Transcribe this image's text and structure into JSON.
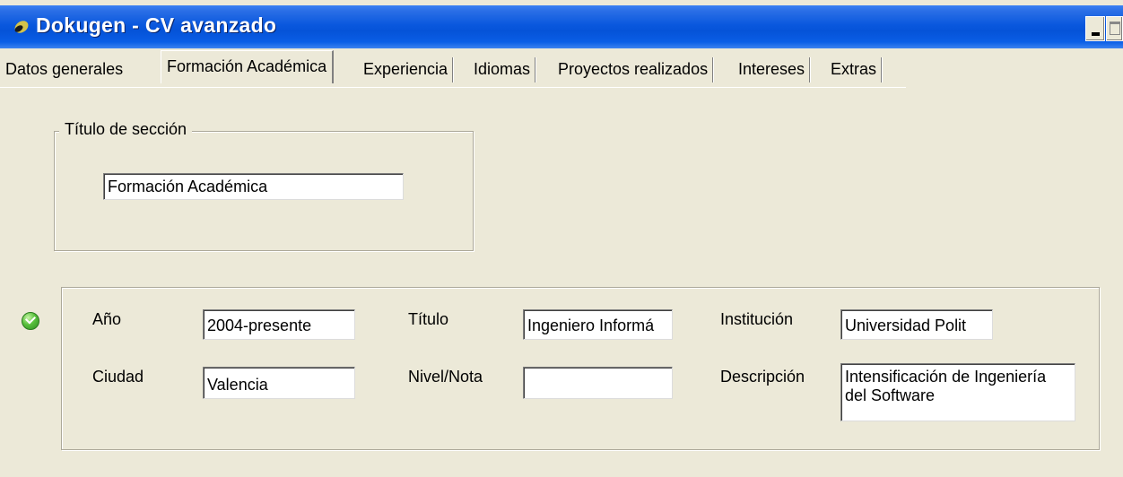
{
  "window": {
    "title": "Dokugen - CV avanzado"
  },
  "tabs": [
    {
      "label": "Datos generales"
    },
    {
      "label": "Formación Académica",
      "active": true
    },
    {
      "label": "Experiencia"
    },
    {
      "label": "Idiomas"
    },
    {
      "label": "Proyectos realizados"
    },
    {
      "label": "Intereses"
    },
    {
      "label": "Extras"
    }
  ],
  "section_title": {
    "legend": "Título de sección",
    "value": "Formación Académica"
  },
  "entry": {
    "status_icon": "check-circle-icon",
    "status_color": "#58c03c",
    "fields": {
      "year": {
        "label": "Año",
        "value": "2004-presente"
      },
      "title": {
        "label": "Título",
        "value": "Ingeniero Informá"
      },
      "institution": {
        "label": "Institución",
        "value": "Universidad Polit"
      },
      "city": {
        "label": "Ciudad",
        "value": "Valencia"
      },
      "grade": {
        "label": "Nivel/Nota",
        "value": ""
      },
      "description": {
        "label": "Descripción",
        "value": "Intensificación de Ingeniería del Software"
      }
    }
  }
}
